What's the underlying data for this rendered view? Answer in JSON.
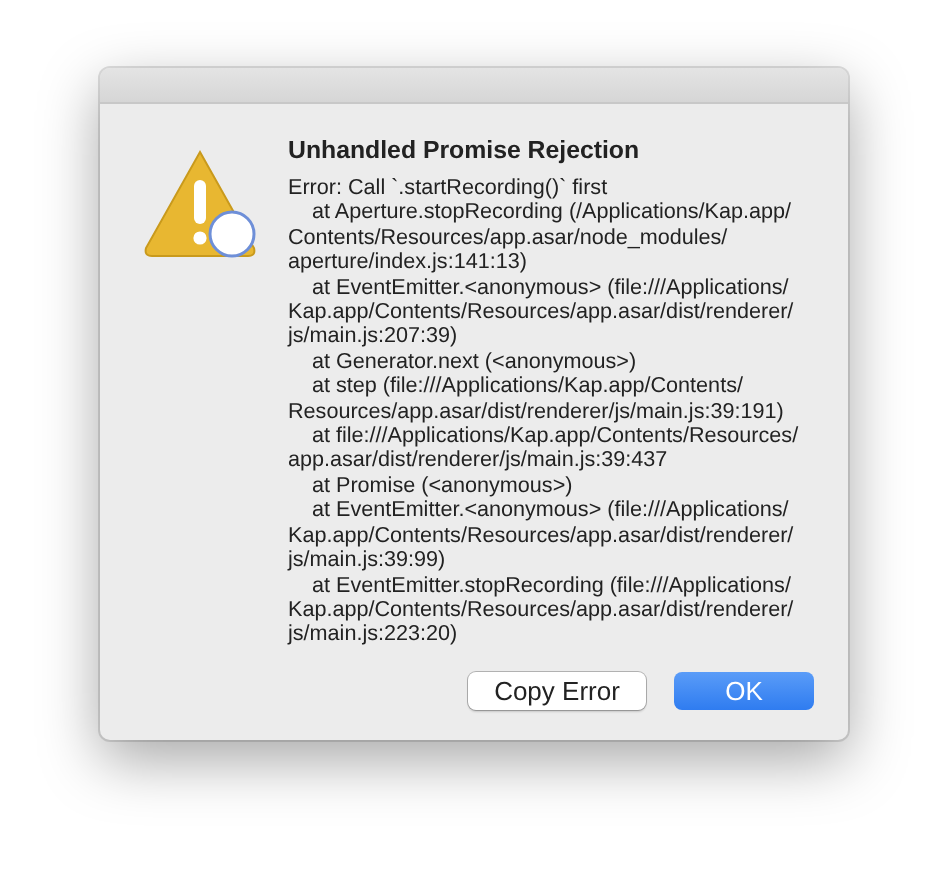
{
  "dialog": {
    "title": "Unhandled Promise Rejection",
    "message": "Error: Call `.startRecording()` first",
    "stack": [
      {
        "lines": [
          "at Aperture.stopRecording (/Applications/Kap.app/",
          "Contents/Resources/app.asar/node_modules/",
          "aperture/index.js:141:13)"
        ]
      },
      {
        "lines": [
          "at EventEmitter.<anonymous> (file:///Applications/",
          "Kap.app/Contents/Resources/app.asar/dist/renderer/",
          "js/main.js:207:39)"
        ]
      },
      {
        "lines": [
          "at Generator.next (<anonymous>)"
        ]
      },
      {
        "lines": [
          "at step (file:///Applications/Kap.app/Contents/",
          "Resources/app.asar/dist/renderer/js/main.js:39:191)"
        ]
      },
      {
        "lines": [
          "at file:///Applications/Kap.app/Contents/Resources/",
          "app.asar/dist/renderer/js/main.js:39:437"
        ]
      },
      {
        "lines": [
          "at Promise (<anonymous>)"
        ]
      },
      {
        "lines": [
          "at EventEmitter.<anonymous> (file:///Applications/",
          "Kap.app/Contents/Resources/app.asar/dist/renderer/",
          "js/main.js:39:99)"
        ]
      },
      {
        "lines": [
          "at EventEmitter.stopRecording (file:///Applications/",
          "Kap.app/Contents/Resources/app.asar/dist/renderer/",
          "js/main.js:223:20)"
        ]
      }
    ],
    "buttons": [
      {
        "label": "Copy Error",
        "kind": "secondary"
      },
      {
        "label": "OK",
        "kind": "default"
      }
    ]
  }
}
